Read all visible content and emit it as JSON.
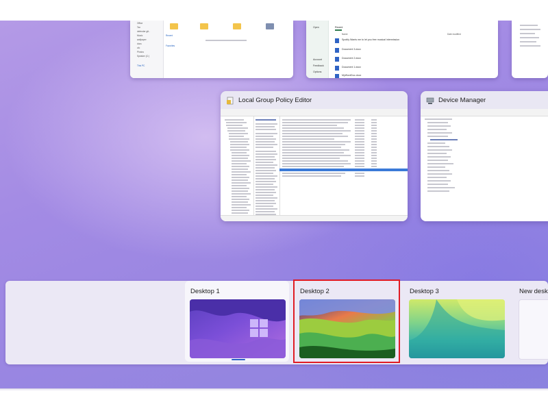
{
  "windows": {
    "top": [
      {
        "name": "file-explorer-window-top",
        "sidebar_items": [
          "Office",
          "Tax",
          "defender gtt..",
          "Music",
          "wallpaper",
          "docs",
          "cfo",
          "Photos",
          "Speaker (C:)"
        ],
        "pc_label": "This PC",
        "quick_access": "Recent",
        "favorites": "Favorites"
      },
      {
        "name": "office-window-top",
        "sidebar": [
          "Open",
          "Account",
          "Feedback",
          "Options"
        ],
        "tab": "Recent",
        "col_name": "Name",
        "col_date": "Date modified",
        "rows": [
          "Spotify Wants me to let you free musical intermission",
          "Document 3.docx",
          "Document 2.docx",
          "Document 1.docx",
          "MyWordDoc.docx"
        ]
      }
    ],
    "group_policy": {
      "title": "Local Group Policy Editor"
    },
    "device_manager": {
      "title": "Device Manager"
    }
  },
  "desktops": {
    "items": [
      {
        "label": "Desktop 1"
      },
      {
        "label": "Desktop 2"
      },
      {
        "label": "Desktop 3"
      }
    ],
    "new_label": "New desktop"
  },
  "taskbar": {
    "icons": [
      "start-icon",
      "task-view-icon",
      "file-explorer-icon",
      "settings-icon",
      "edge-icon",
      "terminal-icon",
      "firefox-icon",
      "chrome-icon",
      "edge-canary-icon",
      "store-icon",
      "todo-icon",
      "onenote-icon",
      "device-manager-icon",
      "notepad-icon",
      "group-policy-icon"
    ]
  },
  "colors": {
    "selection": "#e01b24",
    "accent": "#3b7ad8"
  }
}
